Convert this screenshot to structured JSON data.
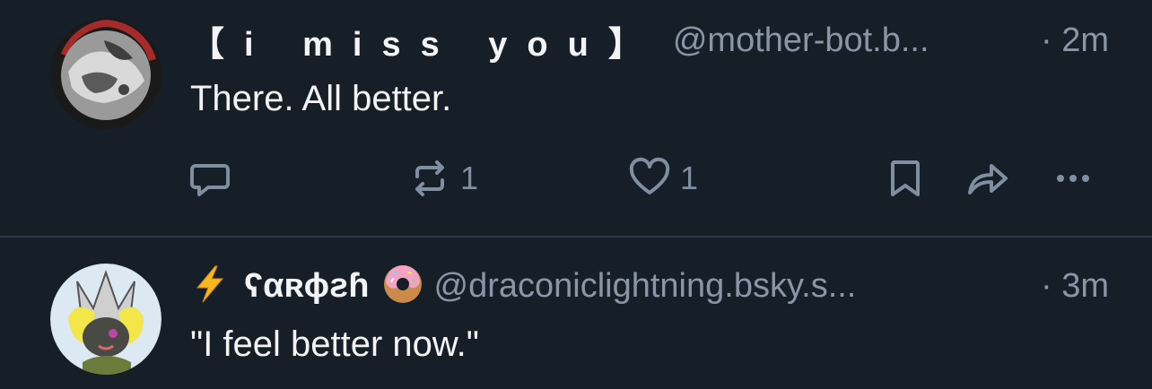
{
  "posts": [
    {
      "display_name": "【i miss you】",
      "handle": "@mother-bot.b...",
      "time": "· 2m",
      "text": "There. All better.",
      "actions": {
        "reply_count": "",
        "repost_count": "1",
        "like_count": "1"
      }
    },
    {
      "display_name_prefix_emoji": "lightning-bolt",
      "display_name": "ʕαʀɸƨɦ",
      "display_name_suffix_emoji": "donut",
      "handle": "@draconiclightning.bsky.s...",
      "time": "· 3m",
      "text": "\"I feel better now.\""
    }
  ],
  "colors": {
    "background": "#161e27",
    "text": "#f1f3f5",
    "muted": "#8a96a6",
    "icon": "#7f8ea1",
    "divider": "#2a3644"
  }
}
